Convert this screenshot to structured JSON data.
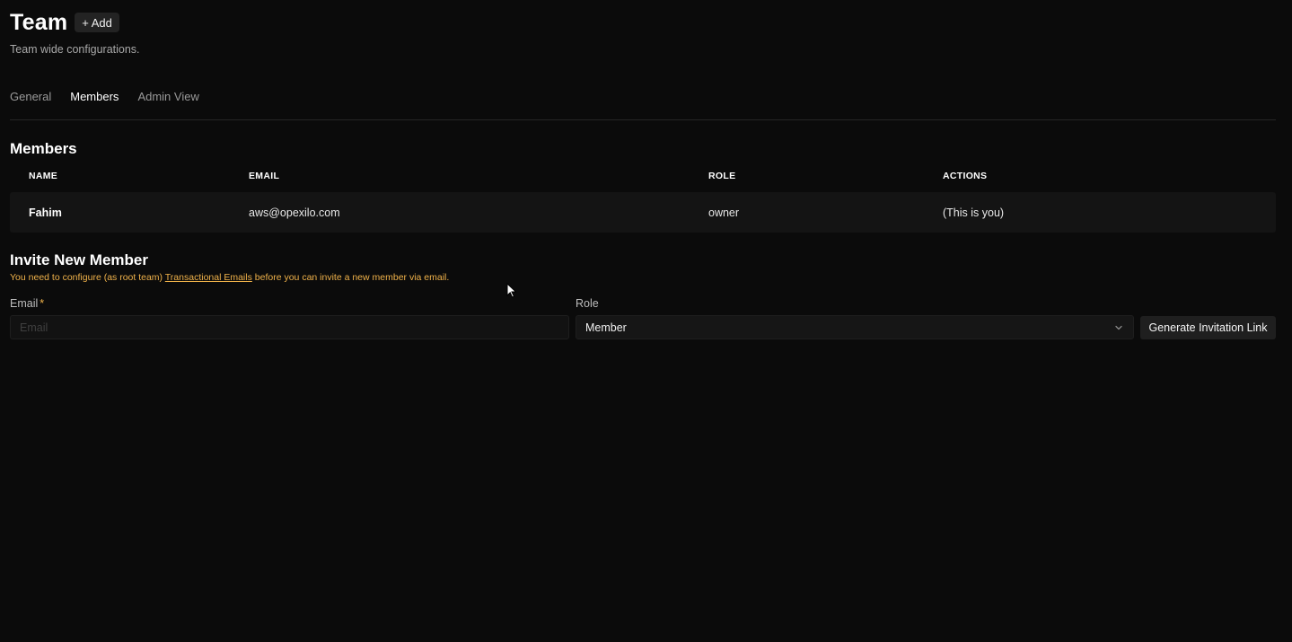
{
  "header": {
    "title": "Team",
    "add_label": "+ Add",
    "subtitle": "Team wide configurations."
  },
  "tabs": [
    {
      "label": "General",
      "active": false
    },
    {
      "label": "Members",
      "active": true
    },
    {
      "label": "Admin View",
      "active": false
    }
  ],
  "members": {
    "title": "Members",
    "columns": [
      "NAME",
      "EMAIL",
      "ROLE",
      "ACTIONS"
    ],
    "rows": [
      {
        "name": "Fahim",
        "email": "aws@opexilo.com",
        "role": "owner",
        "actions": "(This is you)"
      }
    ]
  },
  "invite": {
    "title": "Invite New Member",
    "warning_prefix": "You need to configure (as root team) ",
    "warning_link": "Transactional Emails",
    "warning_suffix": " before you can invite a new member via email.",
    "email_label": "Email",
    "email_required_mark": "*",
    "email_placeholder": "Email",
    "email_value": "",
    "role_label": "Role",
    "role_value": "Member",
    "generate_label": "Generate Invitation Link"
  },
  "colors": {
    "background": "#0b0b0b",
    "warning": "#f0b24a",
    "row_background": "#141414"
  },
  "icons": {
    "role_dropdown": "chevron-down-icon",
    "mouse_pointer": "cursor-arrow-icon"
  }
}
